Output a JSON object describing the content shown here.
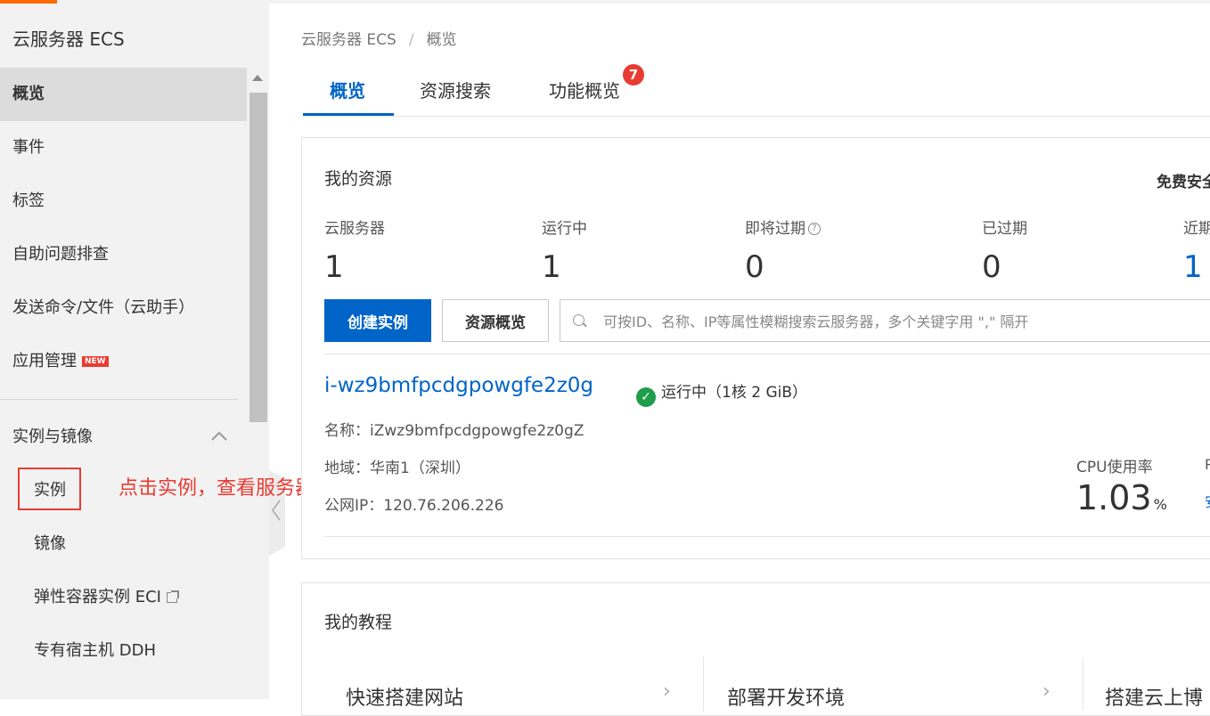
{
  "sidebar": {
    "title": "云服务器 ECS",
    "items": [
      {
        "label": "概览"
      },
      {
        "label": "事件"
      },
      {
        "label": "标签"
      },
      {
        "label": "自助问题排查"
      },
      {
        "label": "发送命令/文件（云助手）"
      },
      {
        "label": "应用管理",
        "badge": "NEW"
      }
    ],
    "section": {
      "label": "实例与镜像",
      "items": [
        {
          "label": "实例"
        },
        {
          "label": "镜像"
        },
        {
          "label": "弹性容器实例 ECI"
        },
        {
          "label": "专有宿主机 DDH"
        }
      ]
    }
  },
  "annotation": {
    "text": "点击实例，查看服务器信息",
    "color": "#e83b32"
  },
  "breadcrumb": {
    "root": "云服务器 ECS",
    "sep": "/",
    "current": "概览"
  },
  "tabs": [
    {
      "label": "概览"
    },
    {
      "label": "资源搜索"
    },
    {
      "label": "功能概览",
      "badge": "7"
    }
  ],
  "resources": {
    "title": "我的资源",
    "free_security": "免费安全",
    "stats": [
      {
        "label": "云服务器",
        "value": "1"
      },
      {
        "label": "运行中",
        "value": "1"
      },
      {
        "label": "即将过期",
        "value": "0"
      },
      {
        "label": "已过期",
        "value": "0"
      },
      {
        "label": "近期",
        "value": "1"
      }
    ],
    "create_button": "创建实例",
    "overview_button": "资源概览",
    "search_placeholder": "可按ID、名称、IP等属性模糊搜索云服务器，多个关键字用 \",\" 隔开",
    "instance": {
      "id": "i-wz9bmfpcdgpowgfe2z0g",
      "status": "运行中（1核 2 GiB）",
      "name": "名称：iZwz9bmfpcdgpowgfe2z0gZ",
      "region": "地域：华南1（深圳）",
      "ip": "公网IP：120.76.206.226",
      "cpu_label": "CPU使用率",
      "cpu_value": "1.03",
      "cpu_unit": "%",
      "extra_label": "P",
      "extra_link": "安"
    }
  },
  "tutorials": {
    "title": "我的教程",
    "items": [
      {
        "label": "快速搭建网站"
      },
      {
        "label": "部署开发环境"
      },
      {
        "label": "搭建云上博"
      }
    ]
  },
  "colors": {
    "accent": "#0064c8",
    "brand": "#ff6a00",
    "highlight": "#e83b32",
    "success": "#1e9e4a"
  }
}
